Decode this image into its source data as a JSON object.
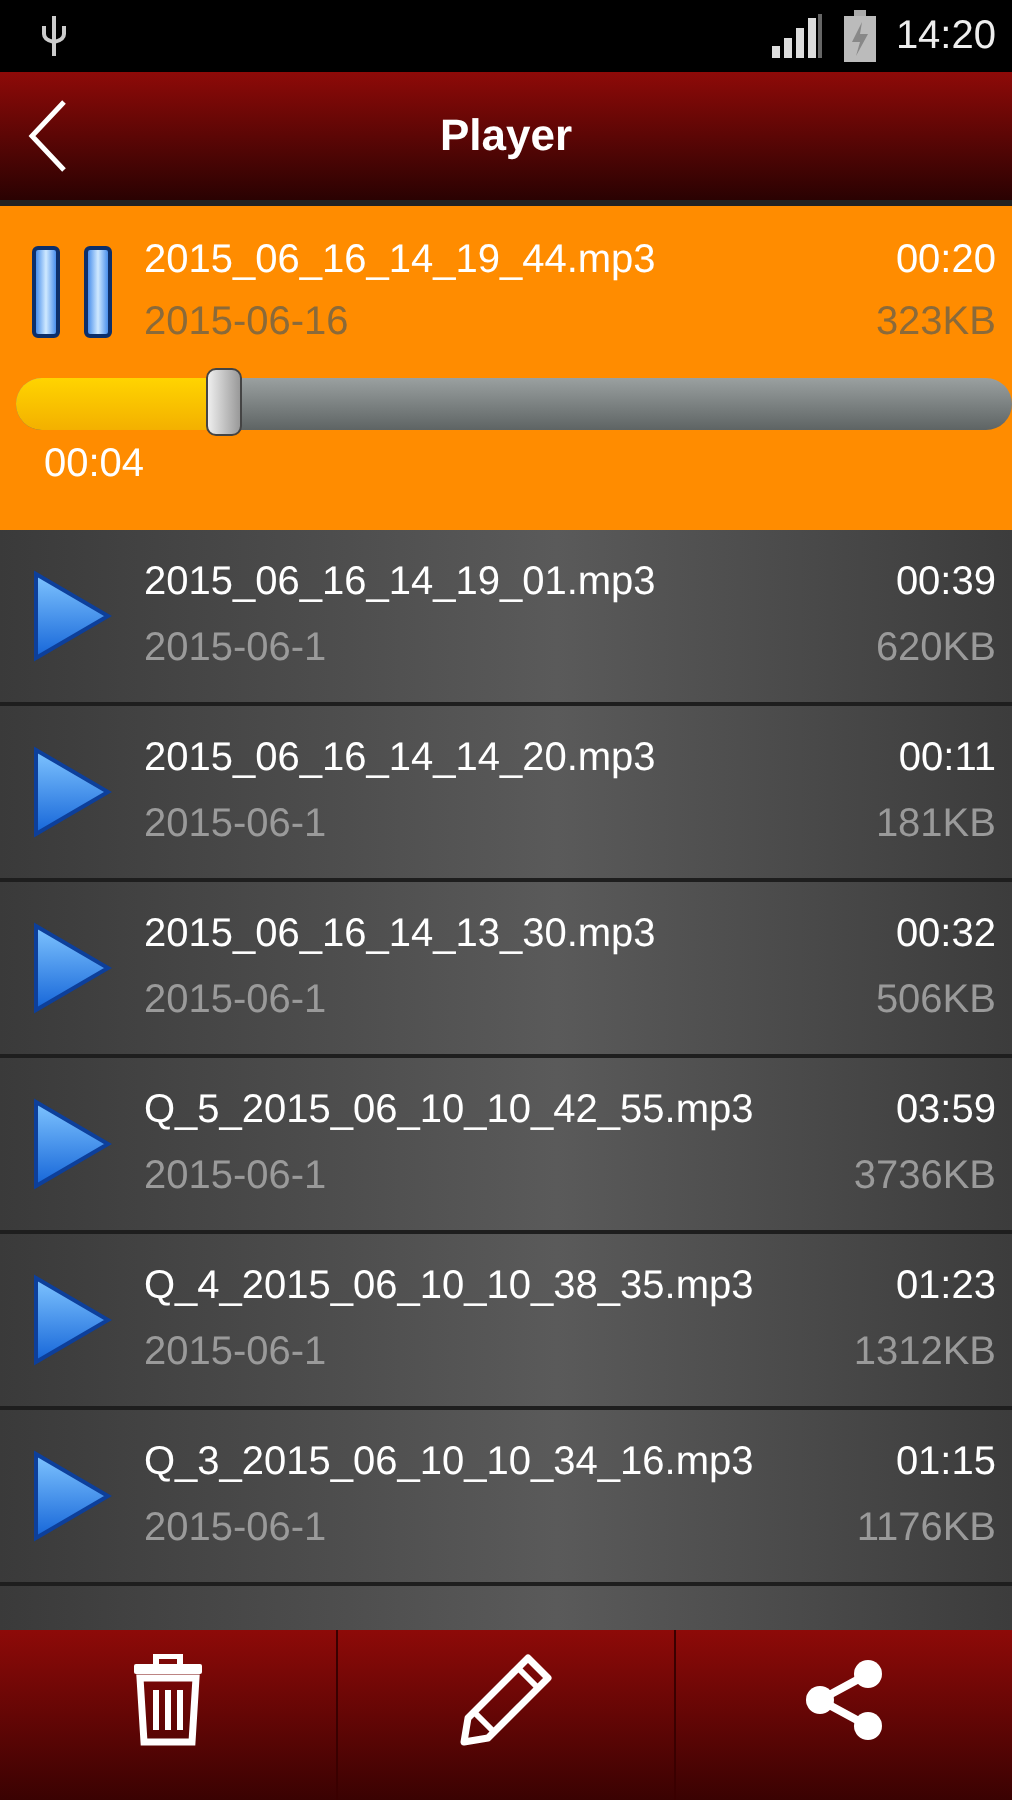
{
  "status_bar": {
    "time": "14:20"
  },
  "toolbar": {
    "title": "Player"
  },
  "current": {
    "name": "2015_06_16_14_19_44.mp3",
    "date": "2015-06-16",
    "duration": "00:20",
    "size": "323KB",
    "playing": true,
    "level": 0.21,
    "elapsed": "00:04"
  },
  "recordings": [
    {
      "name": "2015_06_16_14_19_01.mp3",
      "date": "2015-06-1",
      "duration": "00:39",
      "size": "620KB"
    },
    {
      "name": "2015_06_16_14_14_20.mp3",
      "date": "2015-06-1",
      "duration": "00:11",
      "size": "181KB"
    },
    {
      "name": "2015_06_16_14_13_30.mp3",
      "date": "2015-06-1",
      "duration": "00:32",
      "size": "506KB"
    },
    {
      "name": "Q_5_2015_06_10_10_42_55.mp3",
      "date": "2015-06-1",
      "duration": "03:59",
      "size": "3736KB"
    },
    {
      "name": "Q_4_2015_06_10_10_38_35.mp3",
      "date": "2015-06-1",
      "duration": "01:23",
      "size": "1312KB"
    },
    {
      "name": "Q_3_2015_06_10_10_34_16.mp3",
      "date": "2015-06-1",
      "duration": "01:15",
      "size": "1176KB"
    }
  ]
}
